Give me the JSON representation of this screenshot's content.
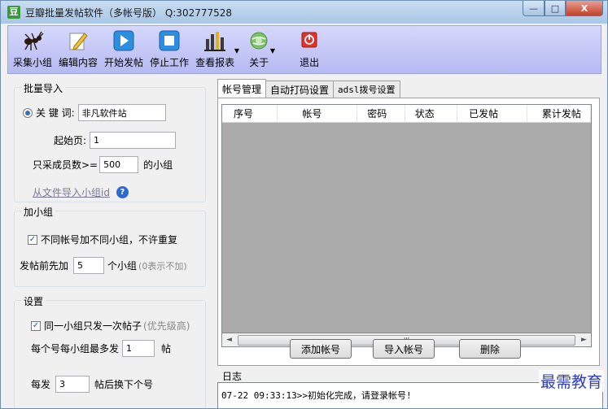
{
  "window": {
    "title": "豆瓣批量发帖软件（多帐号版） Q:302777528",
    "app_icon_text": "豆",
    "controls": {
      "minimize": "—",
      "maximize": "□",
      "close": "X"
    }
  },
  "toolbar": {
    "items": [
      {
        "label": "采集小组",
        "icon": "ant-icon"
      },
      {
        "label": "编辑内容",
        "icon": "pencil-icon"
      },
      {
        "label": "开始发帖",
        "icon": "play-icon"
      },
      {
        "label": "停止工作",
        "icon": "stop-icon"
      },
      {
        "label": "查看报表",
        "icon": "bar-chart-icon"
      },
      {
        "label": "关于",
        "icon": "globe-icon"
      },
      {
        "label": "退出",
        "icon": "power-icon"
      }
    ]
  },
  "import_group": {
    "title": "批量导入",
    "keyword_label": "关 键 词:",
    "keyword_value": "非凡软件站",
    "start_page_label": "起始页:",
    "start_page_value": "1",
    "min_members_label": "只采成员数>=",
    "min_members_value": "500",
    "min_members_suffix": "的小组",
    "import_link": "从文件导入小组id",
    "help_icon": "?"
  },
  "join_group": {
    "title": "加小组",
    "no_dup_label": "不同帐号加不同小组，不许重复",
    "pre_join_label": "发帖前先加",
    "pre_join_value": "5",
    "pre_join_suffix": "个小组",
    "pre_join_hint": "(0表示不加)"
  },
  "settings_group": {
    "title": "设置",
    "once_label": "同一小组只发一次帖子",
    "once_hint": "(优先级高)",
    "max_label": "每个号每小组最多发",
    "max_value": "1",
    "max_suffix": "帖",
    "switch_label": "每发",
    "switch_value": "3",
    "switch_suffix": "帖后换下个号"
  },
  "tabs": [
    {
      "label": "帐号管理",
      "active": true
    },
    {
      "label": "自动打码设置",
      "active": false
    },
    {
      "label": "adsl拨号设置",
      "active": false
    }
  ],
  "accounts_table": {
    "columns": [
      "序号",
      "帐号",
      "密码",
      "状态",
      "已发帖",
      "累计发帖"
    ],
    "rows": []
  },
  "scrollbar": {
    "left": "◄",
    "right": "►",
    "grip": "III"
  },
  "buttons": {
    "add_account": "添加帐号",
    "import_account": "导入帐号",
    "delete": "删除"
  },
  "log": {
    "title": "日志",
    "entries": [
      "07-22 09:33:13>>初始化完成，请登录帐号!"
    ]
  },
  "watermark": "最需教育"
}
